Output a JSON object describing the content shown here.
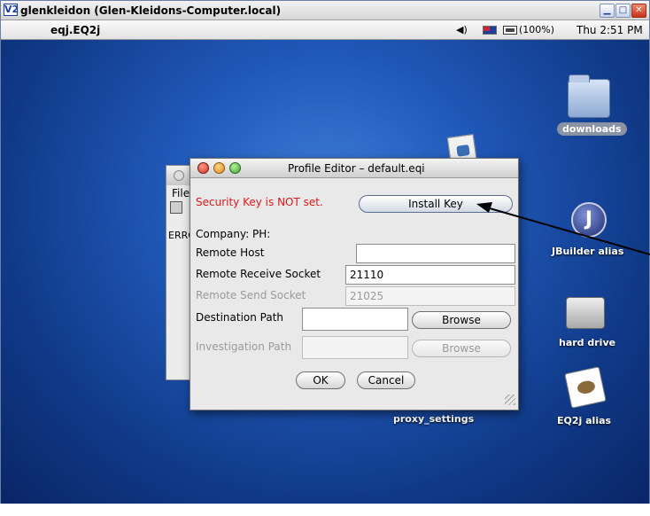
{
  "window": {
    "logo": "V2",
    "title": "glenkleidon (Glen-Kleidons-Computer.local)"
  },
  "menubar": {
    "app_name": "eqj.EQ2j",
    "battery": "(100%)",
    "clock": "Thu 2:51 PM"
  },
  "desktop": {
    "downloads": "downloads",
    "jbuilder": "JBuilder alias",
    "jbuilder_glyph": "J",
    "hard_drive": "hard drive",
    "eq2j": "EQ2j alias",
    "proxy_settings": "proxy_settings"
  },
  "background_window": {
    "menu": "File",
    "error_text": "ERRO"
  },
  "dialog": {
    "title": "Profile Editor – default.eqi",
    "security_message": "Security Key is NOT set.",
    "install_key_label": "Install Key",
    "company_label": "Company:",
    "ph_label": "PH:",
    "remote_host_label": "Remote Host",
    "remote_host_value": "",
    "remote_receive_label": "Remote Receive Socket",
    "remote_receive_value": "21110",
    "remote_send_label": "Remote Send Socket",
    "remote_send_value": "21025",
    "destination_path_label": "Destination Path",
    "destination_path_value": "",
    "investigation_path_label": "Investigation Path",
    "investigation_path_value": "",
    "browse_label": "Browse",
    "ok_label": "OK",
    "cancel_label": "Cancel"
  },
  "colors": {
    "security_warning": "#e0181a",
    "desktop_blue": "#2058b8"
  }
}
